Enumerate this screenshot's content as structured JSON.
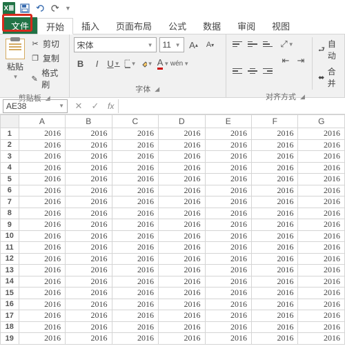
{
  "qat": {
    "save_title": "保存",
    "undo_title": "撤销",
    "redo_title": "重做"
  },
  "tabs": {
    "file": "文件",
    "home": "开始",
    "insert": "插入",
    "layout": "页面布局",
    "formulas": "公式",
    "data": "数据",
    "review": "审阅",
    "view": "视图"
  },
  "clipboard": {
    "paste": "粘贴",
    "cut": "剪切",
    "copy": "复制",
    "painter": "格式刷",
    "group": "剪贴板"
  },
  "font": {
    "name": "宋体",
    "size": "11",
    "group": "字体",
    "bold": "B",
    "italic": "I",
    "underline": "U"
  },
  "align": {
    "group": "对齐方式",
    "wrap": "自动",
    "merge": "合并"
  },
  "namebox": {
    "ref": "AE38"
  },
  "formula": {
    "cancel": "✕",
    "enter": "✓",
    "fx": "fx"
  },
  "grid": {
    "columns": [
      "A",
      "B",
      "C",
      "D",
      "E",
      "F",
      "G"
    ],
    "rows": [
      1,
      2,
      3,
      4,
      5,
      6,
      7,
      8,
      9,
      10,
      11,
      12,
      13,
      14,
      15,
      16,
      17,
      18,
      19
    ],
    "fill_value": "2016"
  }
}
